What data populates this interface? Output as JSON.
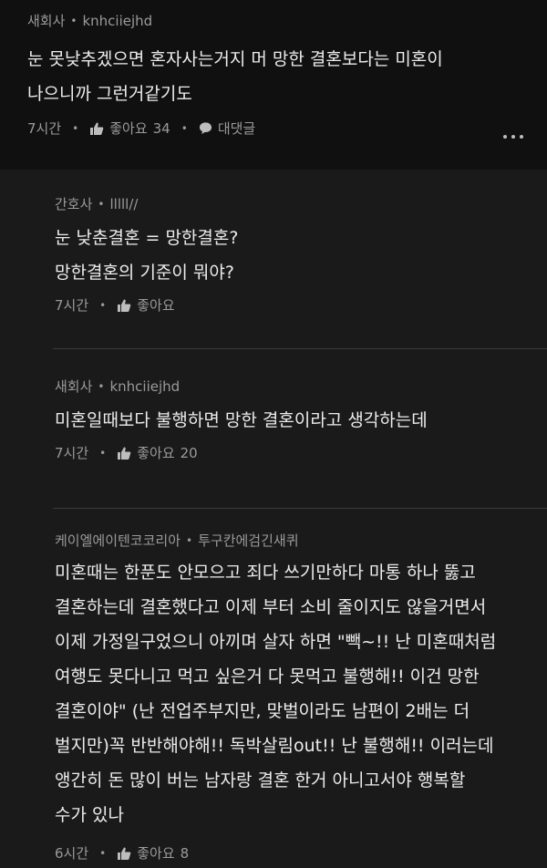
{
  "top": {
    "author_job": "새회사",
    "author_name": "knhciiejhd",
    "text": "눈 못낮추겠으면 혼자사는거지 머 망한 결혼보다는 미혼이\n나으니까 그런거같기도",
    "time": "7시간",
    "like_label": "좋아요",
    "like_count": "34",
    "reply_label": "대댓글"
  },
  "replies": [
    {
      "author_job": "간호사",
      "author_name": "lllll//",
      "text": "눈 낮춘결혼 = 망한결혼?\n망한결혼의 기준이 뭐야?",
      "time": "7시간",
      "like_label": "좋아요",
      "like_count": ""
    },
    {
      "author_job": "새회사",
      "author_name": "knhciiejhd",
      "text": "미혼일때보다 불행하면 망한 결혼이라고 생각하는데",
      "time": "7시간",
      "like_label": "좋아요",
      "like_count": "20"
    },
    {
      "author_job": "케이엘에이텐코코리아",
      "author_name": "투구칸에검긴새퀴",
      "text": "미혼때는 한푼도 안모으고 죄다 쓰기만하다 마통 하나 뚫고\n결혼하는데 결혼했다고 이제 부터 소비 줄이지도 않을거면서\n이제 가정일구었으니 아끼며 살자 하면 \"빽~!! 난 미혼때처럼\n여행도 못다니고 먹고 싶은거 다 못먹고 불행해!! 이건 망한\n결혼이야\" (난 전업주부지만, 맞벌이라도 남편이 2배는 더\n벌지만)꼭 반반해야해!! 독박살림out!! 난 불행해!! 이러는데\n앵간히 돈 많이 버는 남자랑 결혼 한거 아니고서야 행복할\n수가 있나",
      "time": "6시간",
      "like_label": "좋아요",
      "like_count": "8"
    }
  ],
  "colors": {
    "background": "#1a1a1a",
    "top_background": "#101010",
    "muted": "#9a9a9a",
    "text": "#ececec"
  },
  "icons": {
    "like": "thumbs-up-icon",
    "reply": "speech-bubble-icon",
    "more": "more-dots-icon"
  }
}
